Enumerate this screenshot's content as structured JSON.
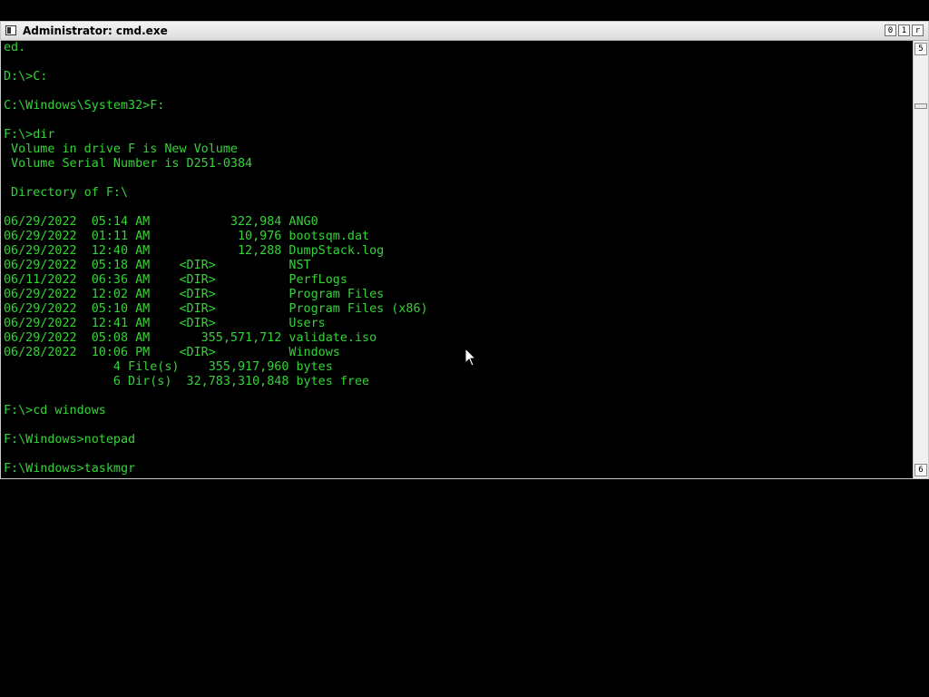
{
  "window": {
    "title": "Administrator: cmd.exe",
    "buttons": {
      "minimize": "0",
      "maximize": "1",
      "close": "r"
    }
  },
  "console": {
    "lines": [
      "ed.",
      "",
      "D:\\>C:",
      "",
      "C:\\Windows\\System32>F:",
      "",
      "F:\\>dir",
      " Volume in drive F is New Volume",
      " Volume Serial Number is D251-0384",
      "",
      " Directory of F:\\",
      "",
      "06/29/2022  05:14 AM           322,984 ANG0",
      "06/29/2022  01:11 AM            10,976 bootsqm.dat",
      "06/29/2022  12:40 AM            12,288 DumpStack.log",
      "06/29/2022  05:18 AM    <DIR>          NST",
      "06/11/2022  06:36 AM    <DIR>          PerfLogs",
      "06/29/2022  12:02 AM    <DIR>          Program Files",
      "06/29/2022  05:10 AM    <DIR>          Program Files (x86)",
      "06/29/2022  12:41 AM    <DIR>          Users",
      "06/29/2022  05:08 AM       355,571,712 validate.iso",
      "06/28/2022  10:06 PM    <DIR>          Windows",
      "               4 File(s)    355,917,960 bytes",
      "               6 Dir(s)  32,783,310,848 bytes free",
      "",
      "F:\\>cd windows",
      "",
      "F:\\Windows>notepad",
      "",
      "F:\\Windows>taskmgr"
    ]
  },
  "scrollbar": {
    "up_label": "5",
    "down_label": "6"
  },
  "icons": {
    "window_icon": "cmd-window-icon",
    "cursor": "mouse-pointer-icon"
  },
  "colors": {
    "console_text": "#36d23a",
    "console_background": "#000000",
    "titlebar": "#e6e6e6"
  }
}
